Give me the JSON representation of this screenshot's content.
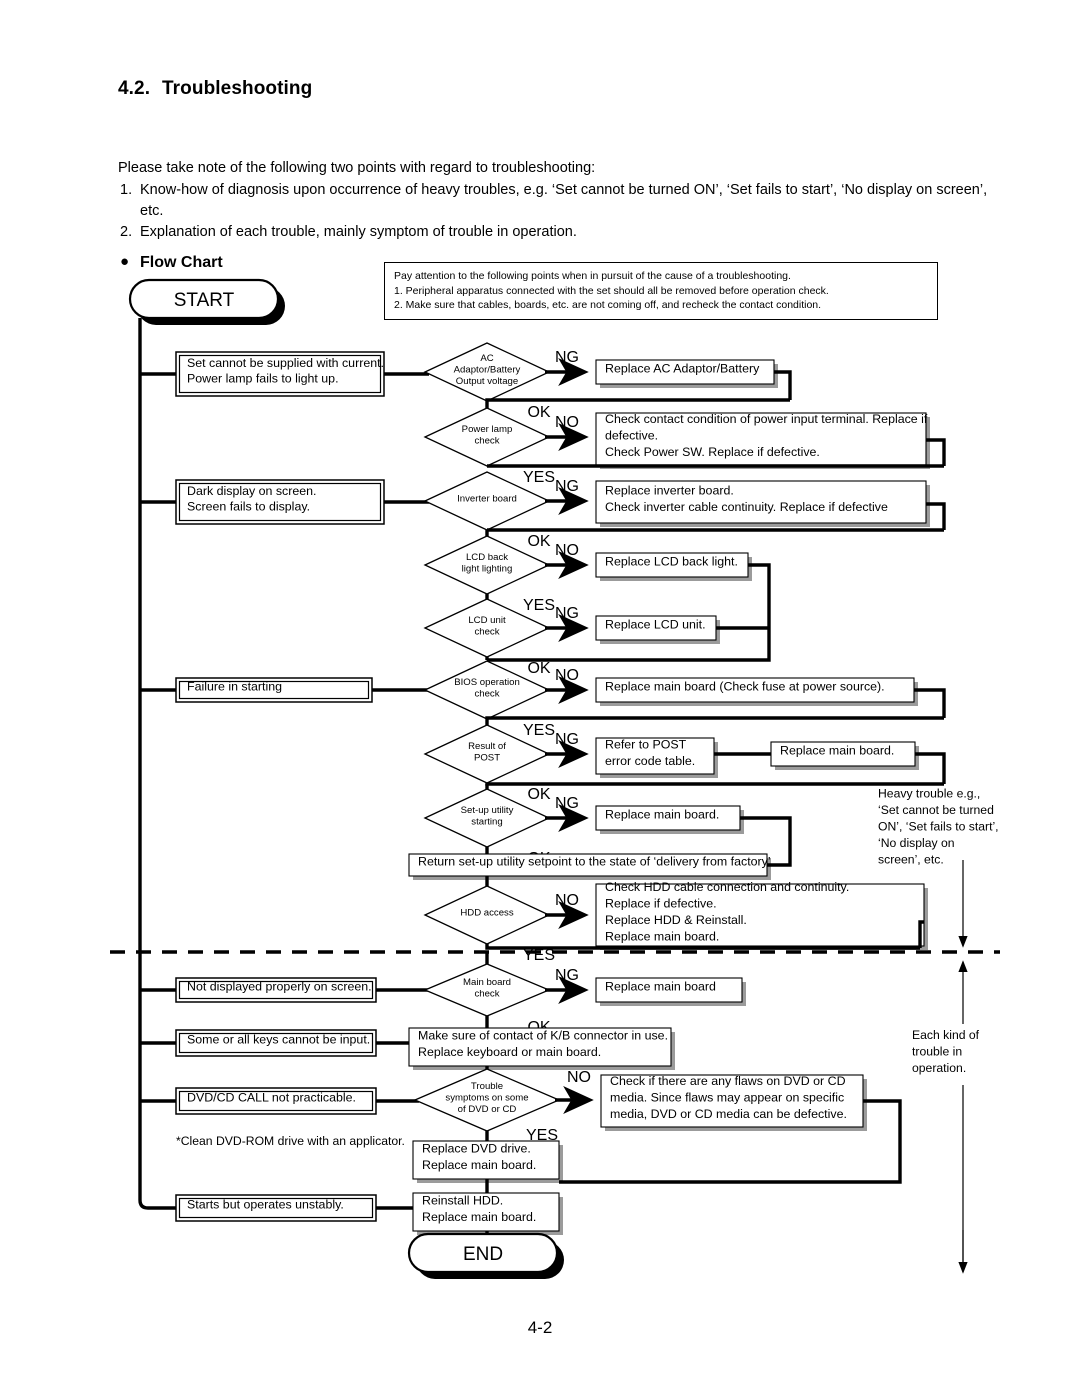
{
  "section": {
    "number": "4.2.",
    "title": "Troubleshooting"
  },
  "intro": {
    "lead": "Please take note of the following two points with regard to troubleshooting:",
    "items": [
      {
        "marker": "1.",
        "text": "Know-how of diagnosis upon occurrence of heavy troubles, e.g. ‘Set cannot be turned ON’, ‘Set fails to start’, ‘No display on screen’, etc."
      },
      {
        "marker": "2.",
        "text": "Explanation of each trouble, mainly symptom of trouble in operation."
      }
    ]
  },
  "flow_chart_heading": "Flow Chart",
  "note_box": {
    "lines": [
      "Pay attention to the following points when in pursuit of the cause of a troubleshooting.",
      "1. Peripheral apparatus connected with the set should all be removed before operation check.",
      "2. Make sure that cables, boards, etc. are not coming off, and recheck the contact condition."
    ]
  },
  "terminals": {
    "start": "START",
    "end": "END"
  },
  "symptoms": [
    {
      "id": "sym-power",
      "lines": [
        "Set cannot be supplied with current.",
        "Power lamp fails to light up."
      ]
    },
    {
      "id": "sym-display",
      "lines": [
        "Dark display on screen.",
        "Screen fails to display."
      ]
    },
    {
      "id": "sym-start",
      "lines": [
        "Failure in starting"
      ]
    },
    {
      "id": "sym-notdisp",
      "lines": [
        "Not displayed properly on screen."
      ]
    },
    {
      "id": "sym-keys",
      "lines": [
        "Some or all keys cannot be input."
      ]
    },
    {
      "id": "sym-dvd",
      "lines": [
        "DVD/CD CALL not practicable."
      ]
    },
    {
      "id": "sym-unstable",
      "lines": [
        "Starts but operates unstably."
      ]
    }
  ],
  "decisions": [
    {
      "id": "dec-ac",
      "lines": [
        "AC",
        "Adaptor/Battery",
        "Output voltage"
      ],
      "fail": "NG",
      "pass": "OK"
    },
    {
      "id": "dec-lamp",
      "lines": [
        "Power lamp",
        "check"
      ],
      "fail": "NO",
      "pass": "YES"
    },
    {
      "id": "dec-inv",
      "lines": [
        "Inverter board"
      ],
      "fail": "NG",
      "pass": "OK"
    },
    {
      "id": "dec-backlit",
      "lines": [
        "LCD back",
        "light lighting"
      ],
      "fail": "NO",
      "pass": "YES"
    },
    {
      "id": "dec-lcd",
      "lines": [
        "LCD unit",
        "check"
      ],
      "fail": "NG",
      "pass": "OK"
    },
    {
      "id": "dec-bios",
      "lines": [
        "BIOS operation",
        "check"
      ],
      "fail": "NO",
      "pass": "YES"
    },
    {
      "id": "dec-post",
      "lines": [
        "Result of",
        "POST"
      ],
      "fail": "NG",
      "pass": "OK"
    },
    {
      "id": "dec-setup",
      "lines": [
        "Set-up utility",
        "starting"
      ],
      "fail": "NG",
      "pass": "OK"
    },
    {
      "id": "dec-hdd",
      "lines": [
        "HDD access"
      ],
      "fail": "NO",
      "pass": "YES"
    },
    {
      "id": "dec-main",
      "lines": [
        "Main board",
        "check"
      ],
      "fail": "NG",
      "pass": "OK"
    },
    {
      "id": "dec-media",
      "lines": [
        "Trouble",
        "symptoms on some",
        "of DVD or CD"
      ],
      "fail": "NO",
      "pass": "YES"
    }
  ],
  "actions": [
    {
      "id": "act-ac",
      "lines": [
        "Replace AC Adaptor/Battery"
      ]
    },
    {
      "id": "act-lamp",
      "lines": [
        "Check contact condition of power input terminal. Replace if",
        "defective.",
        "Check Power SW. Replace if defective."
      ]
    },
    {
      "id": "act-inv",
      "lines": [
        "Replace inverter board.",
        "Check inverter cable continuity. Replace if defective"
      ]
    },
    {
      "id": "act-backlit",
      "lines": [
        "Replace LCD back light."
      ]
    },
    {
      "id": "act-lcd",
      "lines": [
        "Replace LCD unit."
      ]
    },
    {
      "id": "act-bios",
      "lines": [
        "Replace main board (Check fuse at power source)."
      ]
    },
    {
      "id": "act-post",
      "lines": [
        "Refer to POST",
        "error code table."
      ]
    },
    {
      "id": "act-post2",
      "lines": [
        "Replace main board."
      ]
    },
    {
      "id": "act-setup",
      "lines": [
        "Replace main board."
      ]
    },
    {
      "id": "act-setup-ok",
      "lines": [
        "Return set-up utility setpoint to the state of ‘delivery from factory’."
      ]
    },
    {
      "id": "act-hdd",
      "lines": [
        "Check HDD cable connection and continuity.",
        "Replace if defective.",
        "Replace HDD & Reinstall.",
        "Replace main board."
      ]
    },
    {
      "id": "act-main",
      "lines": [
        "Replace main board"
      ]
    },
    {
      "id": "act-kb",
      "lines": [
        "Make sure of contact of K/B connector in use.",
        "Replace keyboard or main board."
      ]
    },
    {
      "id": "act-media",
      "lines": [
        "Check if there are any flaws on DVD or CD",
        "media. Since flaws may appear on specific",
        "media, DVD or CD media can be defective."
      ]
    },
    {
      "id": "act-dvd",
      "lines": [
        "Replace DVD drive.",
        "Replace main board."
      ]
    },
    {
      "id": "act-hddre",
      "lines": [
        "Reinstall HDD.",
        "Replace main board."
      ]
    }
  ],
  "annotations": {
    "heavy_trouble": [
      "Heavy trouble e.g.,",
      "‘Set cannot be turned",
      "ON’, ‘Set fails to start’,",
      "‘No display on",
      "screen’, etc."
    ],
    "each_kind": [
      "Each kind of",
      "trouble in",
      "operation."
    ],
    "clean_note": "*Clean DVD-ROM drive with an applicator."
  },
  "page_number": "4-2"
}
